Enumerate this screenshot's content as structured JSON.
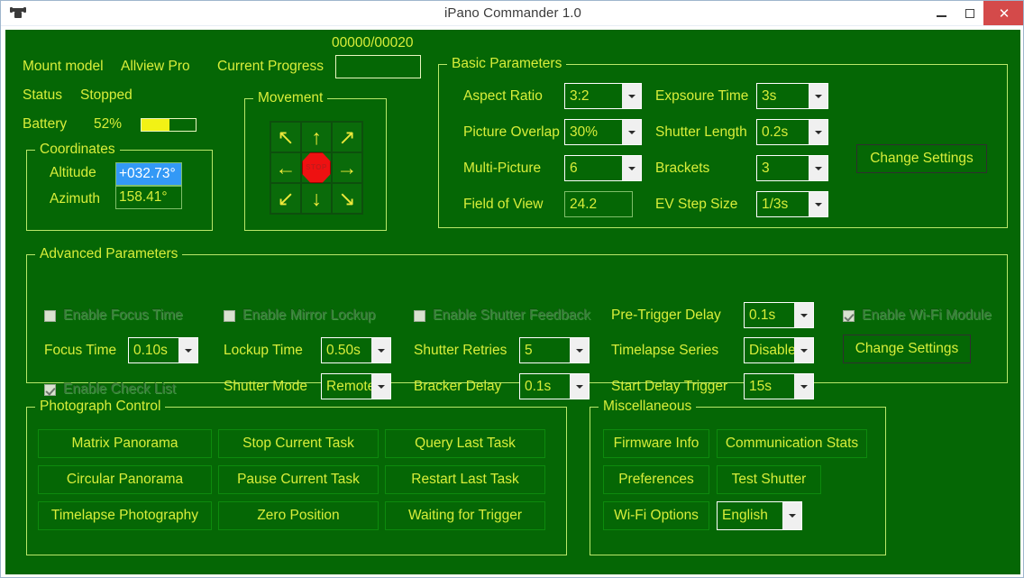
{
  "window": {
    "title": "iPano Commander 1.0",
    "icon": "app-icon",
    "minimize_label": "–",
    "maximize_label": "",
    "close_label": "✕"
  },
  "status": {
    "mount_model_label": "Mount model",
    "mount_model_value": "Allview Pro",
    "status_label": "Status",
    "status_value": "Stopped",
    "battery_label": "Battery",
    "battery_value": "52%",
    "battery_percent": 52
  },
  "progress": {
    "label": "Current Progress",
    "counter": "00000/00020",
    "bar_percent": 0
  },
  "coordinates": {
    "title": "Coordinates",
    "altitude_label": "Altitude",
    "altitude_value": "+032.73°",
    "azimuth_label": "Azimuth",
    "azimuth_value": "158.41°"
  },
  "movement": {
    "title": "Movement",
    "stop_label": "STOP",
    "buttons": [
      {
        "name": "move-up-left",
        "glyph": "↖"
      },
      {
        "name": "move-up",
        "glyph": "↑"
      },
      {
        "name": "move-up-right",
        "glyph": "↗"
      },
      {
        "name": "move-left",
        "glyph": "←"
      },
      {
        "name": "move-stop",
        "glyph": ""
      },
      {
        "name": "move-right",
        "glyph": "→"
      },
      {
        "name": "move-down-left",
        "glyph": "↙"
      },
      {
        "name": "move-down",
        "glyph": "↓"
      },
      {
        "name": "move-down-right",
        "glyph": "↘"
      }
    ]
  },
  "basic": {
    "title": "Basic Parameters",
    "aspect_ratio_label": "Aspect Ratio",
    "aspect_ratio_value": "3:2",
    "picture_overlap_label": "Picture Overlap",
    "picture_overlap_value": "30%",
    "multi_picture_label": "Multi-Picture",
    "multi_picture_value": "6",
    "field_of_view_label": "Field of View",
    "field_of_view_value": "24.2",
    "exposure_time_label": "Expsoure Time",
    "exposure_time_value": "3s",
    "shutter_length_label": "Shutter Length",
    "shutter_length_value": "0.2s",
    "brackets_label": "Brackets",
    "brackets_value": "3",
    "ev_step_size_label": "EV Step Size",
    "ev_step_size_value": "1/3s",
    "change_settings_label": "Change Settings"
  },
  "advanced": {
    "title": "Advanced Parameters",
    "enable_focus_time_label": "Enable Focus Time",
    "enable_focus_time_checked": false,
    "enable_mirror_lockup_label": "Enable Mirror Lockup",
    "enable_mirror_lockup_checked": false,
    "enable_shutter_feedback_label": "Enable Shutter Feedback",
    "enable_shutter_feedback_checked": false,
    "enable_wifi_module_label": "Enable Wi-Fi Module",
    "enable_wifi_module_checked": true,
    "enable_check_list_label": "Enable Check List",
    "enable_check_list_checked": true,
    "focus_time_label": "Focus Time",
    "focus_time_value": "0.10s",
    "lockup_time_label": "Lockup Time",
    "lockup_time_value": "0.50s",
    "shutter_retries_label": "Shutter Retries",
    "shutter_retries_value": "5",
    "pre_trigger_delay_label": "Pre-Trigger Delay",
    "pre_trigger_delay_value": "0.1s",
    "timelapse_series_label": "Timelapse Series",
    "timelapse_series_value": "Disable",
    "shutter_mode_label": "Shutter Mode",
    "shutter_mode_value": "Remote",
    "bracker_delay_label": "Bracker Delay",
    "bracker_delay_value": "0.1s",
    "start_delay_trigger_label": "Start Delay Trigger",
    "start_delay_trigger_value": "15s",
    "change_settings_label": "Change Settings"
  },
  "photograph_control": {
    "title": "Photograph Control",
    "buttons": [
      {
        "name": "matrix-panorama",
        "label": "Matrix Panorama"
      },
      {
        "name": "stop-current-task",
        "label": "Stop Current Task"
      },
      {
        "name": "query-last-task",
        "label": "Query Last Task"
      },
      {
        "name": "circular-panorama",
        "label": "Circular Panorama"
      },
      {
        "name": "pause-current-task",
        "label": "Pause Current Task"
      },
      {
        "name": "restart-last-task",
        "label": "Restart Last Task"
      },
      {
        "name": "timelapse-photography",
        "label": "Timelapse Photography"
      },
      {
        "name": "zero-position",
        "label": "Zero Position"
      },
      {
        "name": "waiting-for-trigger",
        "label": "Waiting for Trigger"
      }
    ]
  },
  "miscellaneous": {
    "title": "Miscellaneous",
    "firmware_info_label": "Firmware Info",
    "communication_stats_label": "Communication Stats",
    "preferences_label": "Preferences",
    "test_shutter_label": "Test Shutter",
    "wifi_options_label": "Wi-Fi Options",
    "language_value": "English"
  },
  "colors": {
    "panel_green": "#056705",
    "text_yellow": "#d8ee3a",
    "border_light": "#b9e86a",
    "selection_blue": "#3399f6",
    "battery_yellow": "#f2f215",
    "stop_red": "#ee1111",
    "close_red": "#d44a4a"
  }
}
